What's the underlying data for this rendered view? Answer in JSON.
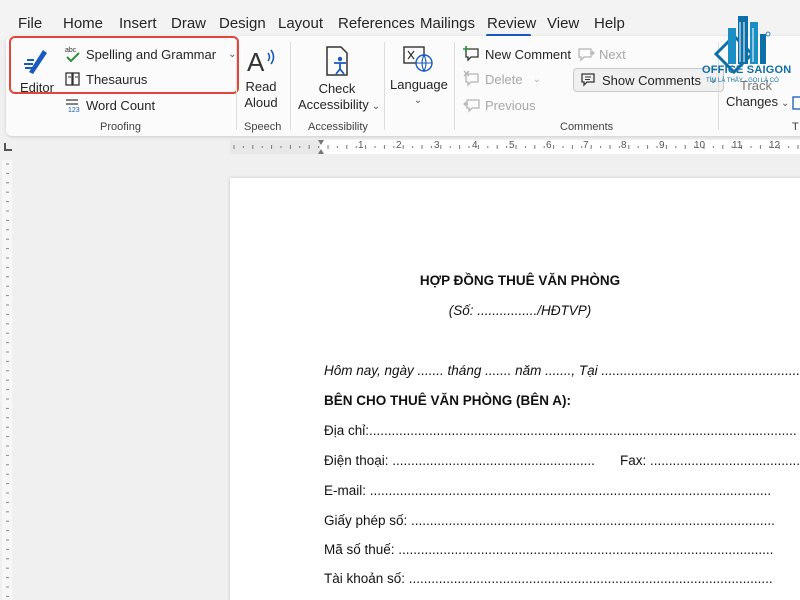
{
  "menu": {
    "tabs": [
      "File",
      "Home",
      "Insert",
      "Draw",
      "Design",
      "Layout",
      "References",
      "Mailings",
      "Review",
      "View",
      "Help"
    ],
    "active": "Review"
  },
  "ribbon": {
    "proofing": {
      "editor": "Editor",
      "spelling": "Spelling and Grammar",
      "thesaurus": "Thesaurus",
      "word_count": "Word Count",
      "label": "Proofing",
      "abc_text": "abc",
      "num_text": "123"
    },
    "speech": {
      "read_aloud_1": "Read",
      "read_aloud_2": "Aloud",
      "label": "Speech"
    },
    "accessibility": {
      "check_1": "Check",
      "check_2": "Accessibility",
      "label": "Accessibility"
    },
    "language": {
      "language": "Language"
    },
    "comments": {
      "new_comment": "New Comment",
      "delete": "Delete",
      "previous": "Previous",
      "next": "Next",
      "show_comments": "Show Comments",
      "label": "Comments"
    },
    "tracking": {
      "track": "Track",
      "changes": "Changes"
    }
  },
  "logo": {
    "name": "OFFICE SAIGON",
    "tagline": "TÌM LÀ THẤY - GỌI LÀ CÓ"
  },
  "ruler": {
    "numbers": [
      "1",
      "2",
      "3",
      "4",
      "5",
      "6",
      "7",
      "8",
      "9",
      "10",
      "11",
      "12"
    ]
  },
  "document": {
    "title": "HỢP ĐỒNG THUÊ VĂN PHÒNG",
    "number_line": "(Số: ................/HĐTVP)",
    "date_line": "Hôm nay, ngày ....... tháng ....... năm ......., Tại ......................................................",
    "party_a": "BÊN CHO THUÊ VĂN PHÒNG (BÊN A):",
    "address": "Địa chỉ:..................................................................................................................",
    "phone": "Điện thoại: ......................................................",
    "fax": "Fax: ...........................................",
    "email": "E-mail: ...........................................................................................................",
    "license": "Giấy phép số: .................................................................................................",
    "tax_code": "Mã số thuế: ....................................................................................................",
    "account": "Tài khoản số: ................................................................................................."
  },
  "colors": {
    "accent": "#185abd",
    "highlight": "#e0463a",
    "logo": "#0d6fa8"
  }
}
